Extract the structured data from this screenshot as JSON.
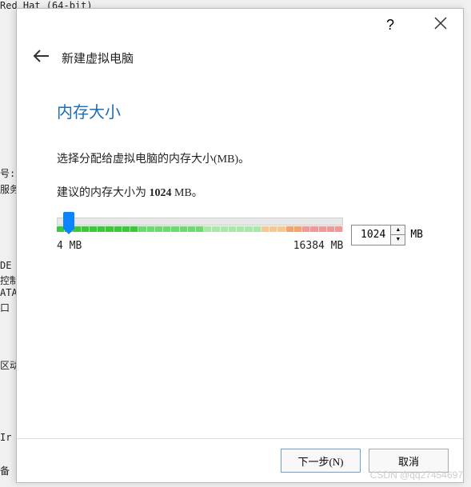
{
  "dialog": {
    "header_title": "新建虚拟电脑",
    "section_title": "内存大小",
    "desc1": "选择分配给虚拟电脑的内存大小(MB)。",
    "desc2_prefix": "建议的内存大小为 ",
    "desc2_value": "1024",
    "desc2_suffix": " MB。",
    "slider_min": "4 MB",
    "slider_max": "16384 MB",
    "value": "1024",
    "unit": "MB",
    "next_btn": "下一步(N)",
    "cancel_btn": "取消",
    "help_symbol": "?"
  },
  "bg": {
    "line1": "Red Hat (64-bit)",
    "label1": "号:",
    "label2": "服务",
    "label3": "DE",
    "label4": "控制",
    "label5": "ATA",
    "label6": "口",
    "label7": "区动",
    "label8": "Ir",
    "label9": "备"
  },
  "watermark": "CSDN @qq27454697"
}
